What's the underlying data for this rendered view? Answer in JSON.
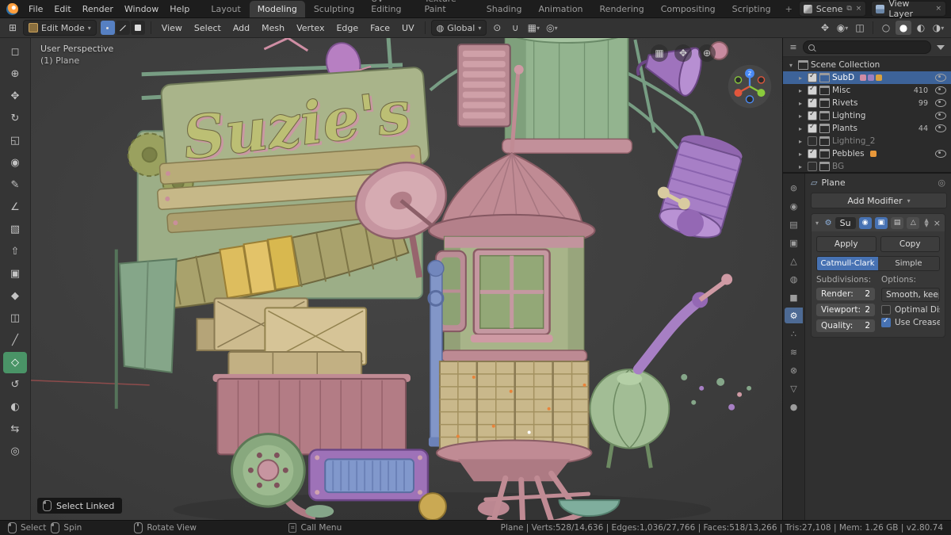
{
  "topbar": {
    "menus": [
      "File",
      "Edit",
      "Render",
      "Window",
      "Help"
    ],
    "tabs": [
      "Layout",
      "Modeling",
      "Sculpting",
      "UV Editing",
      "Texture Paint",
      "Shading",
      "Animation",
      "Rendering",
      "Compositing",
      "Scripting"
    ],
    "add_tab": "+",
    "scene_label": "Scene",
    "view_layer_label": "View Layer"
  },
  "header": {
    "mode": "Edit Mode",
    "menus": [
      "View",
      "Select",
      "Add",
      "Mesh",
      "Vertex",
      "Edge",
      "Face",
      "UV"
    ],
    "orientation": "Global"
  },
  "icons": {
    "tools": [
      "◻",
      "⊕",
      "✥",
      "↻",
      "◱",
      "◉",
      "✎",
      "∠",
      "▧",
      "⇧",
      "▣",
      "◆",
      "◫",
      "╱",
      "◇",
      "↺",
      "◐",
      "⇆",
      "◎"
    ],
    "prop_tabs": [
      "⊚",
      "◉",
      "▤",
      "▣",
      "△",
      "◍",
      "■",
      "⚙",
      "∴",
      "≋",
      "⊗",
      "▽",
      "●"
    ],
    "orientation_globe": "◍",
    "pivot": "⊙",
    "magnet": "∪",
    "snap_target": "▦",
    "proportional": "◎",
    "gizmo_toggle": "✥",
    "overlays": "◉",
    "xray": "◫",
    "shade_wire": "○",
    "shade_solid": "●",
    "shade_material": "◐",
    "shade_render": "◑",
    "nav_grid": "▦",
    "nav_hand": "✥",
    "nav_zoom": "⊕",
    "wrench": "⚙",
    "mod_render": "◉",
    "mod_viewport": "▣",
    "mod_edit": "▤",
    "mod_cage": "△",
    "plane": "▱"
  },
  "viewport": {
    "overlay_line1": "User Perspective",
    "overlay_line2": "(1) Plane",
    "sign_text": "Suzie's",
    "hint_label": "Select Linked",
    "gizmo_z": "Z"
  },
  "outliner": {
    "root": "Scene Collection",
    "items": [
      {
        "label": "SubD",
        "count": ""
      },
      {
        "label": "Misc",
        "count": "410"
      },
      {
        "label": "Rivets",
        "count": "99"
      },
      {
        "label": "Lighting",
        "count": ""
      },
      {
        "label": "Plants",
        "count": "44"
      },
      {
        "label": "Lighting_2",
        "count": ""
      },
      {
        "label": "Pebbles",
        "count": ""
      },
      {
        "label": "BG",
        "count": ""
      }
    ]
  },
  "properties": {
    "object_name": "Plane",
    "add_modifier": "Add Modifier",
    "modifier_name": "Su",
    "apply": "Apply",
    "copy": "Copy",
    "catmull_clark": "Catmull-Clark",
    "simple": "Simple",
    "subdivisions": "Subdivisions:",
    "options": "Options:",
    "render_label": "Render:",
    "render_value": "2",
    "viewport_label": "Viewport:",
    "viewport_value": "2",
    "quality_label": "Quality:",
    "quality_value": "2",
    "uv_smooth": "Smooth, keep c...",
    "optimal_display": "Optimal Displ...",
    "use_creases": "Use Creases"
  },
  "statusbar": {
    "select": "Select",
    "spin": "Spin",
    "rotate_view": "Rotate View",
    "call_menu": "Call Menu",
    "stats": "Plane | Verts:528/14,636 | Edges:1,036/27,766 | Faces:518/13,266 | Tris:27,108 | Mem: 1.26 GB | v2.80.74"
  }
}
